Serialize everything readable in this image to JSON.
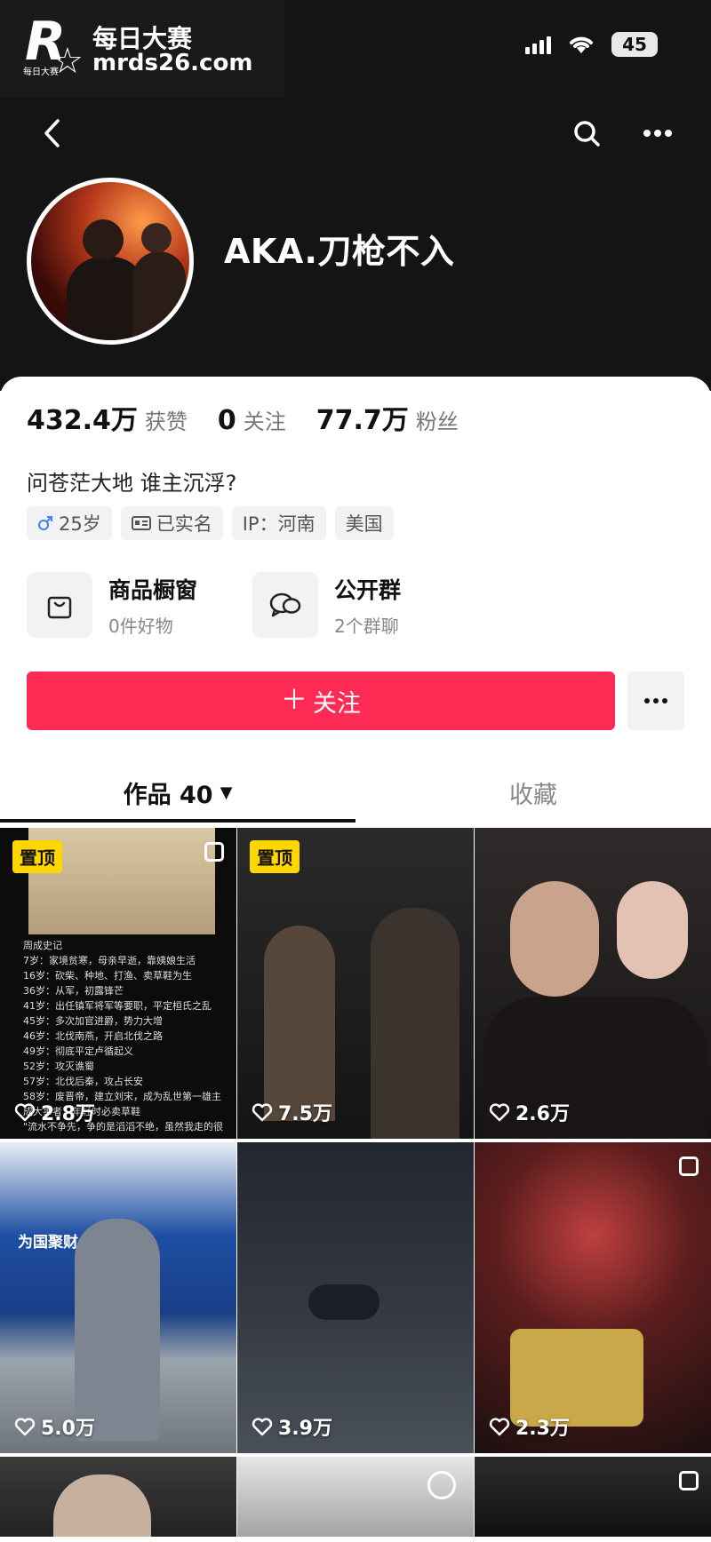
{
  "watermark": {
    "line1": "每日大赛",
    "line2": "mrds26.com",
    "logo_letter": "R",
    "logo_small": "每日大赛"
  },
  "status_bar": {
    "battery": "45"
  },
  "profile": {
    "username": "AKA.刀枪不入",
    "stats": [
      {
        "value": "432.4万",
        "label": "获赞"
      },
      {
        "value": "0",
        "label": "关注"
      },
      {
        "value": "77.7万",
        "label": "粉丝"
      }
    ],
    "bio": "问苍茫大地 谁主沉浮?",
    "tags": [
      {
        "icon": "male-icon",
        "text": "25岁"
      },
      {
        "icon": "id-card-icon",
        "text": "已实名"
      },
      {
        "icon": "",
        "text": "IP：河南"
      },
      {
        "icon": "",
        "text": "美国"
      }
    ],
    "features": [
      {
        "icon": "shopping-bag-icon",
        "title": "商品橱窗",
        "subtitle": "0件好物"
      },
      {
        "icon": "group-chat-icon",
        "title": "公开群",
        "subtitle": "2个群聊"
      }
    ],
    "follow_label": "关注",
    "follow_color": "#fe2c55"
  },
  "tabs": {
    "works": "作品 40",
    "favorites": "收藏"
  },
  "videos": [
    {
      "pinned": "置顶",
      "likes": "2.8万",
      "multi": true,
      "caption_lines": [
        "周成史记",
        "7岁：家境贫寒，母亲早逝，靠姨娘生活",
        "16岁：砍柴、种地、打渔、卖草鞋为生",
        "36岁：从军，初露锋芒",
        "41岁：出任镇军将军等要职，平定桓氏之乱",
        "45岁：多次加官进爵，势力大增",
        "46岁：北伐南燕，开启北伐之路",
        "49岁：彻底平定卢循起义",
        "52岁：攻灭谯蜀",
        "57岁：北伐后秦，攻占长安",
        "58岁：废晋帝，建立刘宋，成为乱世第一雄主",
        "成大事者，年轻时必卖草鞋",
        "\"流水不争先，争的是滔滔不绝，虽然我走的很"
      ]
    },
    {
      "pinned": "置顶",
      "likes": "7.5万",
      "multi": false,
      "caption_lines": []
    },
    {
      "pinned": "",
      "likes": "2.6万",
      "multi": false,
      "caption_lines": []
    },
    {
      "pinned": "",
      "likes": "5.0万",
      "multi": false,
      "caption_lines": [],
      "sign": "为国聚财 为民收税"
    },
    {
      "pinned": "",
      "likes": "3.9万",
      "multi": false,
      "caption_lines": []
    },
    {
      "pinned": "",
      "likes": "2.3万",
      "multi": true,
      "caption_lines": []
    },
    {
      "pinned": "",
      "likes": "",
      "multi": false,
      "caption_lines": []
    },
    {
      "pinned": "",
      "likes": "",
      "multi": false,
      "caption_lines": []
    },
    {
      "pinned": "",
      "likes": "",
      "multi": true,
      "caption_lines": []
    }
  ]
}
